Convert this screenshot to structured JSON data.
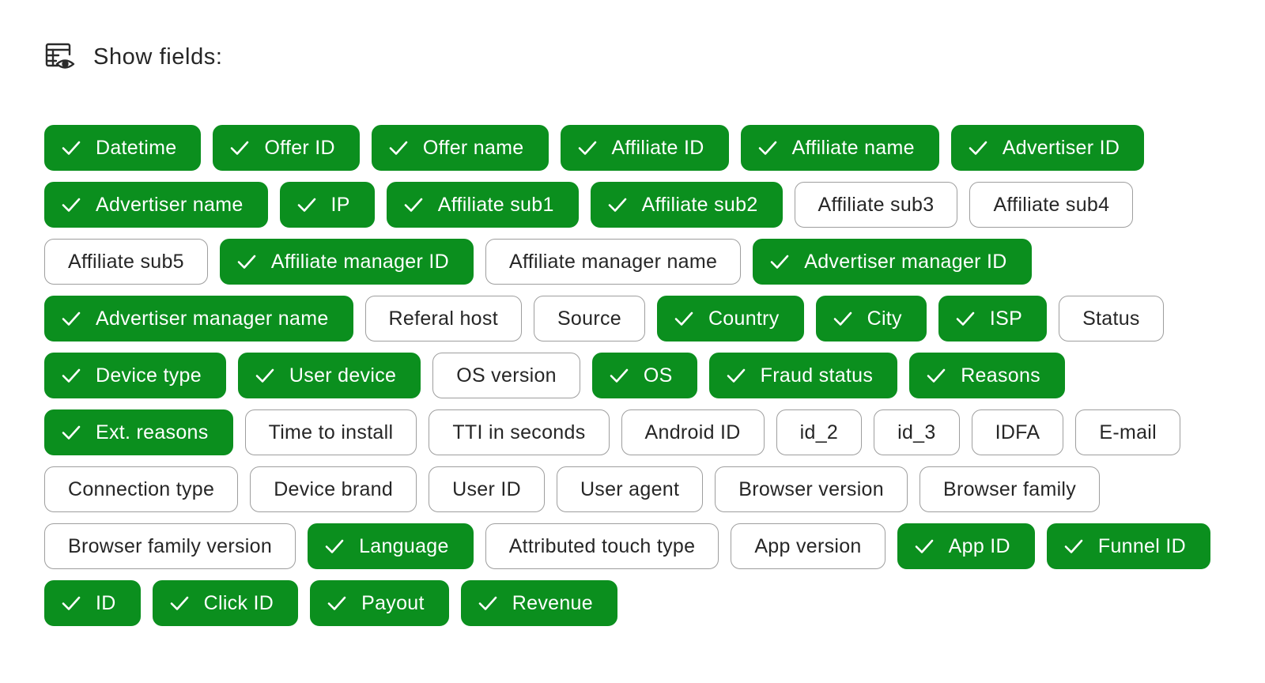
{
  "header": {
    "title": "Show fields:",
    "icon": "table-view-eye-icon"
  },
  "colors": {
    "selected_bg": "#0b8f1e",
    "unselected_border": "#9e9e9e",
    "text": "#262626"
  },
  "rows": [
    [
      {
        "label": "Datetime",
        "selected": true
      },
      {
        "label": "Offer ID",
        "selected": true
      },
      {
        "label": "Offer name",
        "selected": true
      },
      {
        "label": "Affiliate ID",
        "selected": true
      },
      {
        "label": "Affiliate name",
        "selected": true
      },
      {
        "label": "Advertiser ID",
        "selected": true
      }
    ],
    [
      {
        "label": "Advertiser name",
        "selected": true
      },
      {
        "label": "IP",
        "selected": true
      },
      {
        "label": "Affiliate sub1",
        "selected": true
      },
      {
        "label": "Affiliate sub2",
        "selected": true
      },
      {
        "label": "Affiliate sub3",
        "selected": false
      },
      {
        "label": "Affiliate sub4",
        "selected": false
      }
    ],
    [
      {
        "label": "Affiliate sub5",
        "selected": false
      },
      {
        "label": "Affiliate manager ID",
        "selected": true
      },
      {
        "label": "Affiliate manager name",
        "selected": false
      },
      {
        "label": "Advertiser manager ID",
        "selected": true
      }
    ],
    [
      {
        "label": "Advertiser manager name",
        "selected": true
      },
      {
        "label": "Referal host",
        "selected": false
      },
      {
        "label": "Source",
        "selected": false
      },
      {
        "label": "Country",
        "selected": true
      },
      {
        "label": "City",
        "selected": true
      },
      {
        "label": "ISP",
        "selected": true
      },
      {
        "label": "Status",
        "selected": false
      }
    ],
    [
      {
        "label": "Device type",
        "selected": true
      },
      {
        "label": "User device",
        "selected": true
      },
      {
        "label": "OS version",
        "selected": false
      },
      {
        "label": "OS",
        "selected": true
      },
      {
        "label": "Fraud status",
        "selected": true
      },
      {
        "label": "Reasons",
        "selected": true
      }
    ],
    [
      {
        "label": "Ext. reasons",
        "selected": true
      },
      {
        "label": "Time to install",
        "selected": false
      },
      {
        "label": "TTI in seconds",
        "selected": false
      },
      {
        "label": "Android ID",
        "selected": false
      },
      {
        "label": "id_2",
        "selected": false
      },
      {
        "label": "id_3",
        "selected": false
      },
      {
        "label": "IDFA",
        "selected": false
      },
      {
        "label": "E-mail",
        "selected": false
      }
    ],
    [
      {
        "label": "Connection type",
        "selected": false
      },
      {
        "label": "Device brand",
        "selected": false
      },
      {
        "label": "User ID",
        "selected": false
      },
      {
        "label": "User agent",
        "selected": false
      },
      {
        "label": "Browser version",
        "selected": false
      },
      {
        "label": "Browser family",
        "selected": false
      }
    ],
    [
      {
        "label": "Browser family version",
        "selected": false
      },
      {
        "label": "Language",
        "selected": true
      },
      {
        "label": "Attributed touch type",
        "selected": false
      },
      {
        "label": "App version",
        "selected": false
      },
      {
        "label": "App ID",
        "selected": true
      },
      {
        "label": "Funnel ID",
        "selected": true
      }
    ],
    [
      {
        "label": "ID",
        "selected": true
      },
      {
        "label": "Click ID",
        "selected": true
      },
      {
        "label": "Payout",
        "selected": true
      },
      {
        "label": "Revenue",
        "selected": true
      }
    ]
  ]
}
